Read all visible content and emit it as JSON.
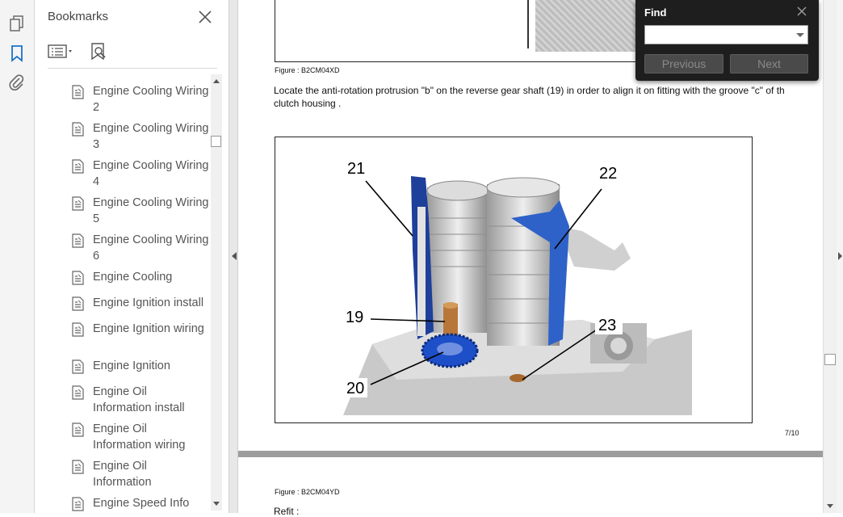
{
  "bookmarks_panel": {
    "title": "Bookmarks",
    "items": [
      {
        "label": "Engine Cooling Wiring 2"
      },
      {
        "label": "Engine Cooling Wiring 3"
      },
      {
        "label": "Engine Cooling Wiring 4"
      },
      {
        "label": "Engine Cooling Wiring 5"
      },
      {
        "label": "Engine Cooling Wiring 6"
      },
      {
        "label": "Engine Cooling"
      },
      {
        "label": "Engine Ignition install"
      },
      {
        "label": "Engine Ignition wiring"
      },
      {
        "label": "Engine Ignition"
      },
      {
        "label": "Engine Oil Information install"
      },
      {
        "label": "Engine Oil Information wiring"
      },
      {
        "label": "Engine Oil Information"
      },
      {
        "label": "Engine Speed Info"
      }
    ]
  },
  "document": {
    "caption_top": "Figure : B2CM04XD",
    "instruction": "Locate the anti-rotation protrusion \"b\" on the reverse gear shaft (19) in order to align it on fitting with the groove \"c\" of th",
    "instruction_line2": "clutch housing .",
    "figure_labels": {
      "l21": "21",
      "l22": "22",
      "l19": "19",
      "l23": "23",
      "l20": "20"
    },
    "page_number": "7/10",
    "caption_next": "Figure : B2CM04YD",
    "next_text": "Refit :"
  },
  "find_dialog": {
    "title": "Find",
    "input_value": "",
    "previous_label": "Previous",
    "next_label": "Next"
  },
  "icons": {
    "rail": [
      "pages-icon",
      "bookmark-icon",
      "attachment-icon"
    ],
    "panel_tools": [
      "options-menu-icon",
      "find-bookmark-icon"
    ]
  }
}
